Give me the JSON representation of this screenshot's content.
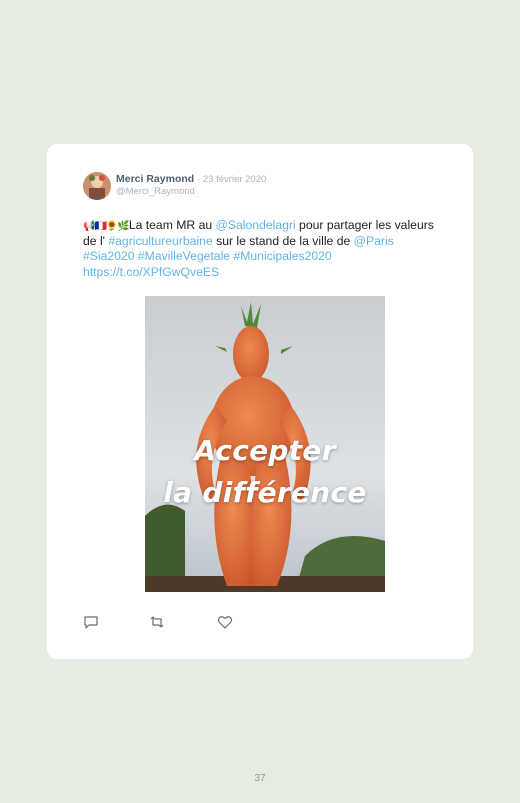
{
  "tweet": {
    "author_name": "Merci Raymond",
    "date": "· 23 février 2020",
    "handle": "@Merci_Raymond",
    "emoji_prefix": "📢🇫🇷🌻🌿",
    "text_segments": [
      {
        "text": "La team MR au ",
        "type": "text"
      },
      {
        "text": "@Salondelagri",
        "type": "link"
      },
      {
        "text": " pour partager les valeurs de l' ",
        "type": "text"
      },
      {
        "text": "#agricultureurbaine",
        "type": "link"
      },
      {
        "text": " sur le stand de la ville de ",
        "type": "text"
      },
      {
        "text": "@Paris",
        "type": "link"
      },
      {
        "text": " ",
        "type": "text"
      },
      {
        "text": "#Sia2020",
        "type": "link"
      },
      {
        "text": " ",
        "type": "text"
      },
      {
        "text": "#MavilleVegetale",
        "type": "link"
      },
      {
        "text": " ",
        "type": "text"
      },
      {
        "text": "#Municipales2020",
        "type": "link"
      },
      {
        "text": " ",
        "type": "text"
      },
      {
        "text": "https://t.co/XPfGwQveES",
        "type": "link"
      }
    ],
    "image_caption_line1": "Accepter",
    "image_caption_line2": "la différence",
    "actions": [
      "reply-icon",
      "retweet-icon",
      "like-icon"
    ]
  },
  "page_number": "37",
  "colors": {
    "background": "#e6ede0",
    "card": "#ffffff",
    "link": "#5fb4ea",
    "name": "#4f5e6a",
    "meta": "#aab4bc",
    "carrot": "#e06a34"
  }
}
